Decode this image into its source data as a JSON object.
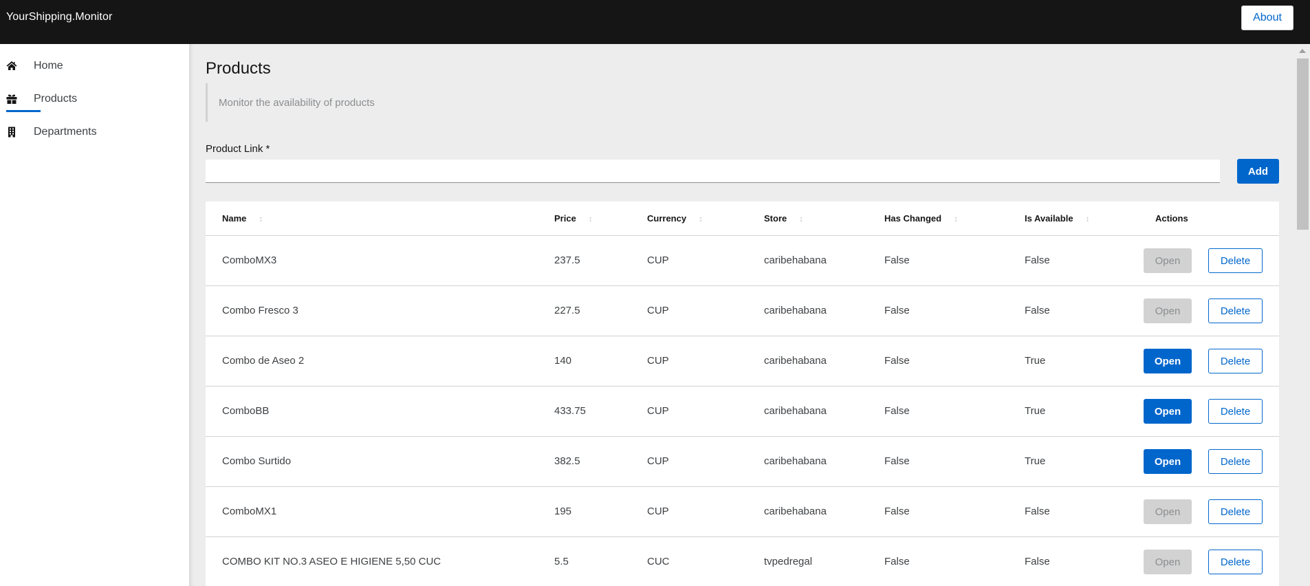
{
  "app": {
    "title": "YourShipping.Monitor",
    "about_label": "About"
  },
  "sidebar": {
    "items": [
      {
        "label": "Home",
        "icon": "home-icon",
        "active": false
      },
      {
        "label": "Products",
        "icon": "gift-icon",
        "active": true
      },
      {
        "label": "Departments",
        "icon": "building-icon",
        "active": false
      }
    ]
  },
  "page": {
    "title": "Products",
    "description": "Monitor the availability of products",
    "field_label": "Product Link *",
    "field_value": "",
    "add_label": "Add"
  },
  "table": {
    "columns": [
      "Name",
      "Price",
      "Currency",
      "Store",
      "Has Changed",
      "Is Available",
      "Actions"
    ],
    "sort_icon": "↕",
    "open_label": "Open",
    "delete_label": "Delete",
    "rows": [
      {
        "name": "ComboMX3",
        "price": "237.5",
        "currency": "CUP",
        "store": "caribehabana",
        "has_changed": "False",
        "is_available": "False"
      },
      {
        "name": "Combo Fresco 3",
        "price": "227.5",
        "currency": "CUP",
        "store": "caribehabana",
        "has_changed": "False",
        "is_available": "False"
      },
      {
        "name": "Combo de Aseo 2",
        "price": "140",
        "currency": "CUP",
        "store": "caribehabana",
        "has_changed": "False",
        "is_available": "True"
      },
      {
        "name": "ComboBB",
        "price": "433.75",
        "currency": "CUP",
        "store": "caribehabana",
        "has_changed": "False",
        "is_available": "True"
      },
      {
        "name": "Combo Surtido",
        "price": "382.5",
        "currency": "CUP",
        "store": "caribehabana",
        "has_changed": "False",
        "is_available": "True"
      },
      {
        "name": "ComboMX1",
        "price": "195",
        "currency": "CUP",
        "store": "caribehabana",
        "has_changed": "False",
        "is_available": "False"
      },
      {
        "name": "COMBO KIT NO.3 ASEO E HIGIENE 5,50 CUC",
        "price": "5.5",
        "currency": "CUC",
        "store": "tvpedregal",
        "has_changed": "False",
        "is_available": "False"
      }
    ]
  },
  "colors": {
    "accent": "#0066cc",
    "topbar": "#151515",
    "disabled": "#d2d2d2"
  }
}
